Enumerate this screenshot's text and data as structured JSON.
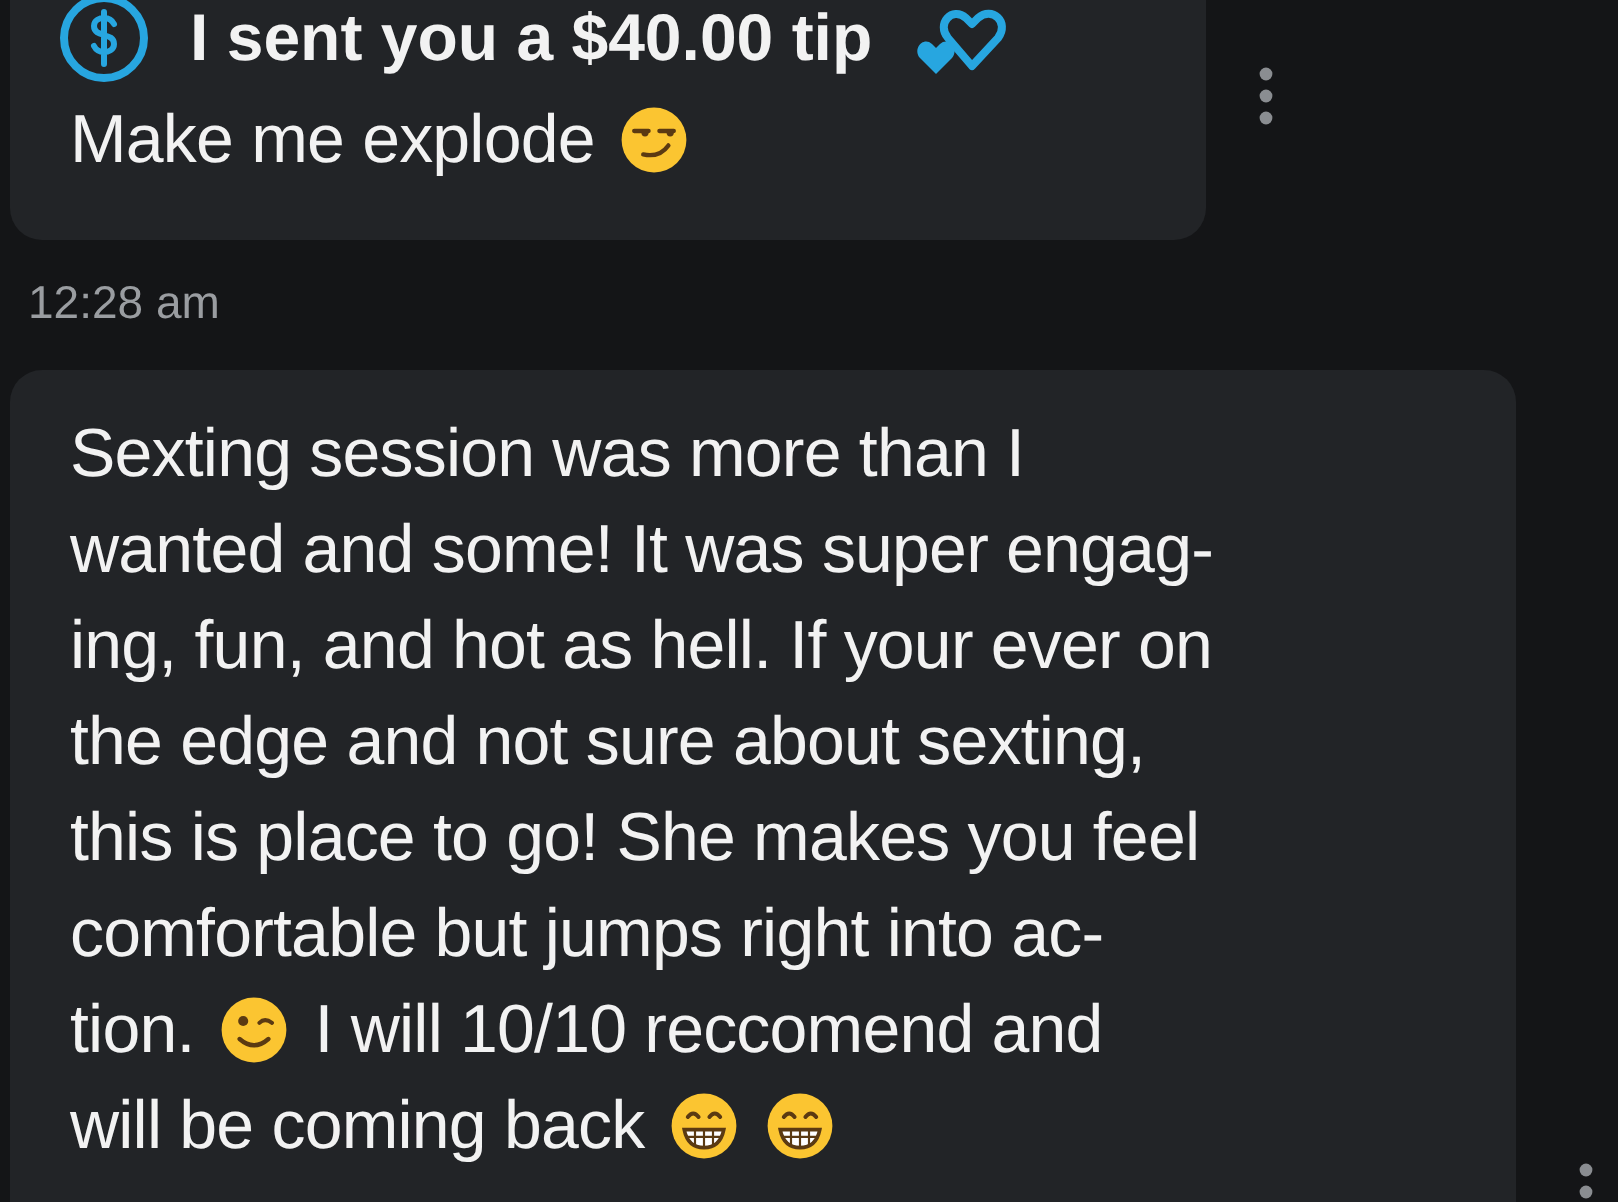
{
  "messages": [
    {
      "tip": "I sent you a $40.00 tip",
      "lines": [
        [
          {
            "kind": "text",
            "text": "Make me explode"
          },
          {
            "kind": "smirk"
          }
        ]
      ],
      "time": "12:28 am"
    },
    {
      "lines": [
        [
          {
            "kind": "text",
            "text": "Sexting session was more than I"
          }
        ],
        [
          {
            "kind": "text",
            "text": "wanted and some! It was super engag-"
          }
        ],
        [
          {
            "kind": "text",
            "text": "ing, fun, and hot as hell. If your ever on"
          }
        ],
        [
          {
            "kind": "text",
            "text": "the edge and not sure about sexting,"
          }
        ],
        [
          {
            "kind": "text",
            "text": "this is place to go! She makes you feel"
          }
        ],
        [
          {
            "kind": "text",
            "text": "comfortable but jumps right into ac-"
          }
        ],
        [
          {
            "kind": "text",
            "text": "tion."
          },
          {
            "kind": "wink"
          },
          {
            "kind": "text",
            "text": "I will 10/10 reccomend and"
          }
        ],
        [
          {
            "kind": "text",
            "text": "will be coming back"
          },
          {
            "kind": "grin"
          },
          {
            "kind": "grin"
          }
        ]
      ]
    }
  ]
}
